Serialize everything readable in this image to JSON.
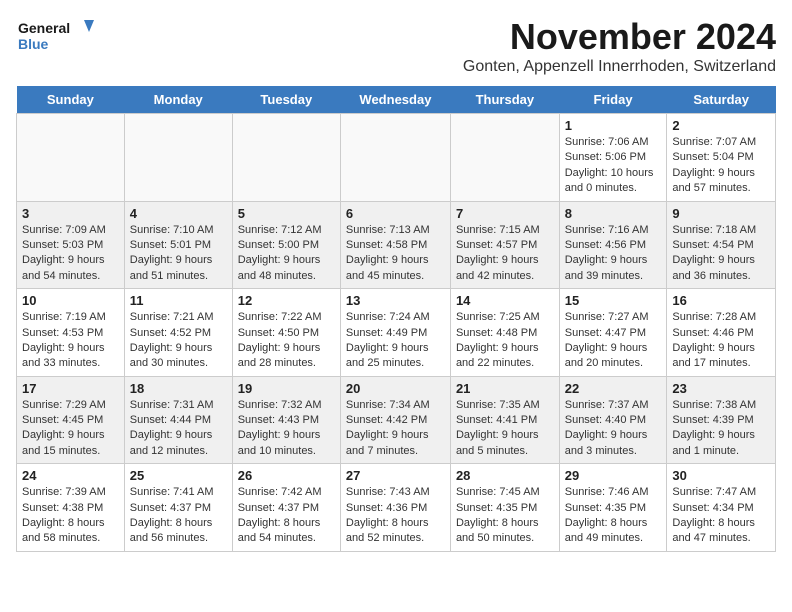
{
  "logo": {
    "line1": "General",
    "line2": "Blue"
  },
  "title": "November 2024",
  "location": "Gonten, Appenzell Innerrhoden, Switzerland",
  "days_of_week": [
    "Sunday",
    "Monday",
    "Tuesday",
    "Wednesday",
    "Thursday",
    "Friday",
    "Saturday"
  ],
  "weeks": [
    [
      {
        "day": "",
        "info": ""
      },
      {
        "day": "",
        "info": ""
      },
      {
        "day": "",
        "info": ""
      },
      {
        "day": "",
        "info": ""
      },
      {
        "day": "",
        "info": ""
      },
      {
        "day": "1",
        "info": "Sunrise: 7:06 AM\nSunset: 5:06 PM\nDaylight: 10 hours\nand 0 minutes."
      },
      {
        "day": "2",
        "info": "Sunrise: 7:07 AM\nSunset: 5:04 PM\nDaylight: 9 hours\nand 57 minutes."
      }
    ],
    [
      {
        "day": "3",
        "info": "Sunrise: 7:09 AM\nSunset: 5:03 PM\nDaylight: 9 hours\nand 54 minutes."
      },
      {
        "day": "4",
        "info": "Sunrise: 7:10 AM\nSunset: 5:01 PM\nDaylight: 9 hours\nand 51 minutes."
      },
      {
        "day": "5",
        "info": "Sunrise: 7:12 AM\nSunset: 5:00 PM\nDaylight: 9 hours\nand 48 minutes."
      },
      {
        "day": "6",
        "info": "Sunrise: 7:13 AM\nSunset: 4:58 PM\nDaylight: 9 hours\nand 45 minutes."
      },
      {
        "day": "7",
        "info": "Sunrise: 7:15 AM\nSunset: 4:57 PM\nDaylight: 9 hours\nand 42 minutes."
      },
      {
        "day": "8",
        "info": "Sunrise: 7:16 AM\nSunset: 4:56 PM\nDaylight: 9 hours\nand 39 minutes."
      },
      {
        "day": "9",
        "info": "Sunrise: 7:18 AM\nSunset: 4:54 PM\nDaylight: 9 hours\nand 36 minutes."
      }
    ],
    [
      {
        "day": "10",
        "info": "Sunrise: 7:19 AM\nSunset: 4:53 PM\nDaylight: 9 hours\nand 33 minutes."
      },
      {
        "day": "11",
        "info": "Sunrise: 7:21 AM\nSunset: 4:52 PM\nDaylight: 9 hours\nand 30 minutes."
      },
      {
        "day": "12",
        "info": "Sunrise: 7:22 AM\nSunset: 4:50 PM\nDaylight: 9 hours\nand 28 minutes."
      },
      {
        "day": "13",
        "info": "Sunrise: 7:24 AM\nSunset: 4:49 PM\nDaylight: 9 hours\nand 25 minutes."
      },
      {
        "day": "14",
        "info": "Sunrise: 7:25 AM\nSunset: 4:48 PM\nDaylight: 9 hours\nand 22 minutes."
      },
      {
        "day": "15",
        "info": "Sunrise: 7:27 AM\nSunset: 4:47 PM\nDaylight: 9 hours\nand 20 minutes."
      },
      {
        "day": "16",
        "info": "Sunrise: 7:28 AM\nSunset: 4:46 PM\nDaylight: 9 hours\nand 17 minutes."
      }
    ],
    [
      {
        "day": "17",
        "info": "Sunrise: 7:29 AM\nSunset: 4:45 PM\nDaylight: 9 hours\nand 15 minutes."
      },
      {
        "day": "18",
        "info": "Sunrise: 7:31 AM\nSunset: 4:44 PM\nDaylight: 9 hours\nand 12 minutes."
      },
      {
        "day": "19",
        "info": "Sunrise: 7:32 AM\nSunset: 4:43 PM\nDaylight: 9 hours\nand 10 minutes."
      },
      {
        "day": "20",
        "info": "Sunrise: 7:34 AM\nSunset: 4:42 PM\nDaylight: 9 hours\nand 7 minutes."
      },
      {
        "day": "21",
        "info": "Sunrise: 7:35 AM\nSunset: 4:41 PM\nDaylight: 9 hours\nand 5 minutes."
      },
      {
        "day": "22",
        "info": "Sunrise: 7:37 AM\nSunset: 4:40 PM\nDaylight: 9 hours\nand 3 minutes."
      },
      {
        "day": "23",
        "info": "Sunrise: 7:38 AM\nSunset: 4:39 PM\nDaylight: 9 hours\nand 1 minute."
      }
    ],
    [
      {
        "day": "24",
        "info": "Sunrise: 7:39 AM\nSunset: 4:38 PM\nDaylight: 8 hours\nand 58 minutes."
      },
      {
        "day": "25",
        "info": "Sunrise: 7:41 AM\nSunset: 4:37 PM\nDaylight: 8 hours\nand 56 minutes."
      },
      {
        "day": "26",
        "info": "Sunrise: 7:42 AM\nSunset: 4:37 PM\nDaylight: 8 hours\nand 54 minutes."
      },
      {
        "day": "27",
        "info": "Sunrise: 7:43 AM\nSunset: 4:36 PM\nDaylight: 8 hours\nand 52 minutes."
      },
      {
        "day": "28",
        "info": "Sunrise: 7:45 AM\nSunset: 4:35 PM\nDaylight: 8 hours\nand 50 minutes."
      },
      {
        "day": "29",
        "info": "Sunrise: 7:46 AM\nSunset: 4:35 PM\nDaylight: 8 hours\nand 49 minutes."
      },
      {
        "day": "30",
        "info": "Sunrise: 7:47 AM\nSunset: 4:34 PM\nDaylight: 8 hours\nand 47 minutes."
      }
    ]
  ]
}
